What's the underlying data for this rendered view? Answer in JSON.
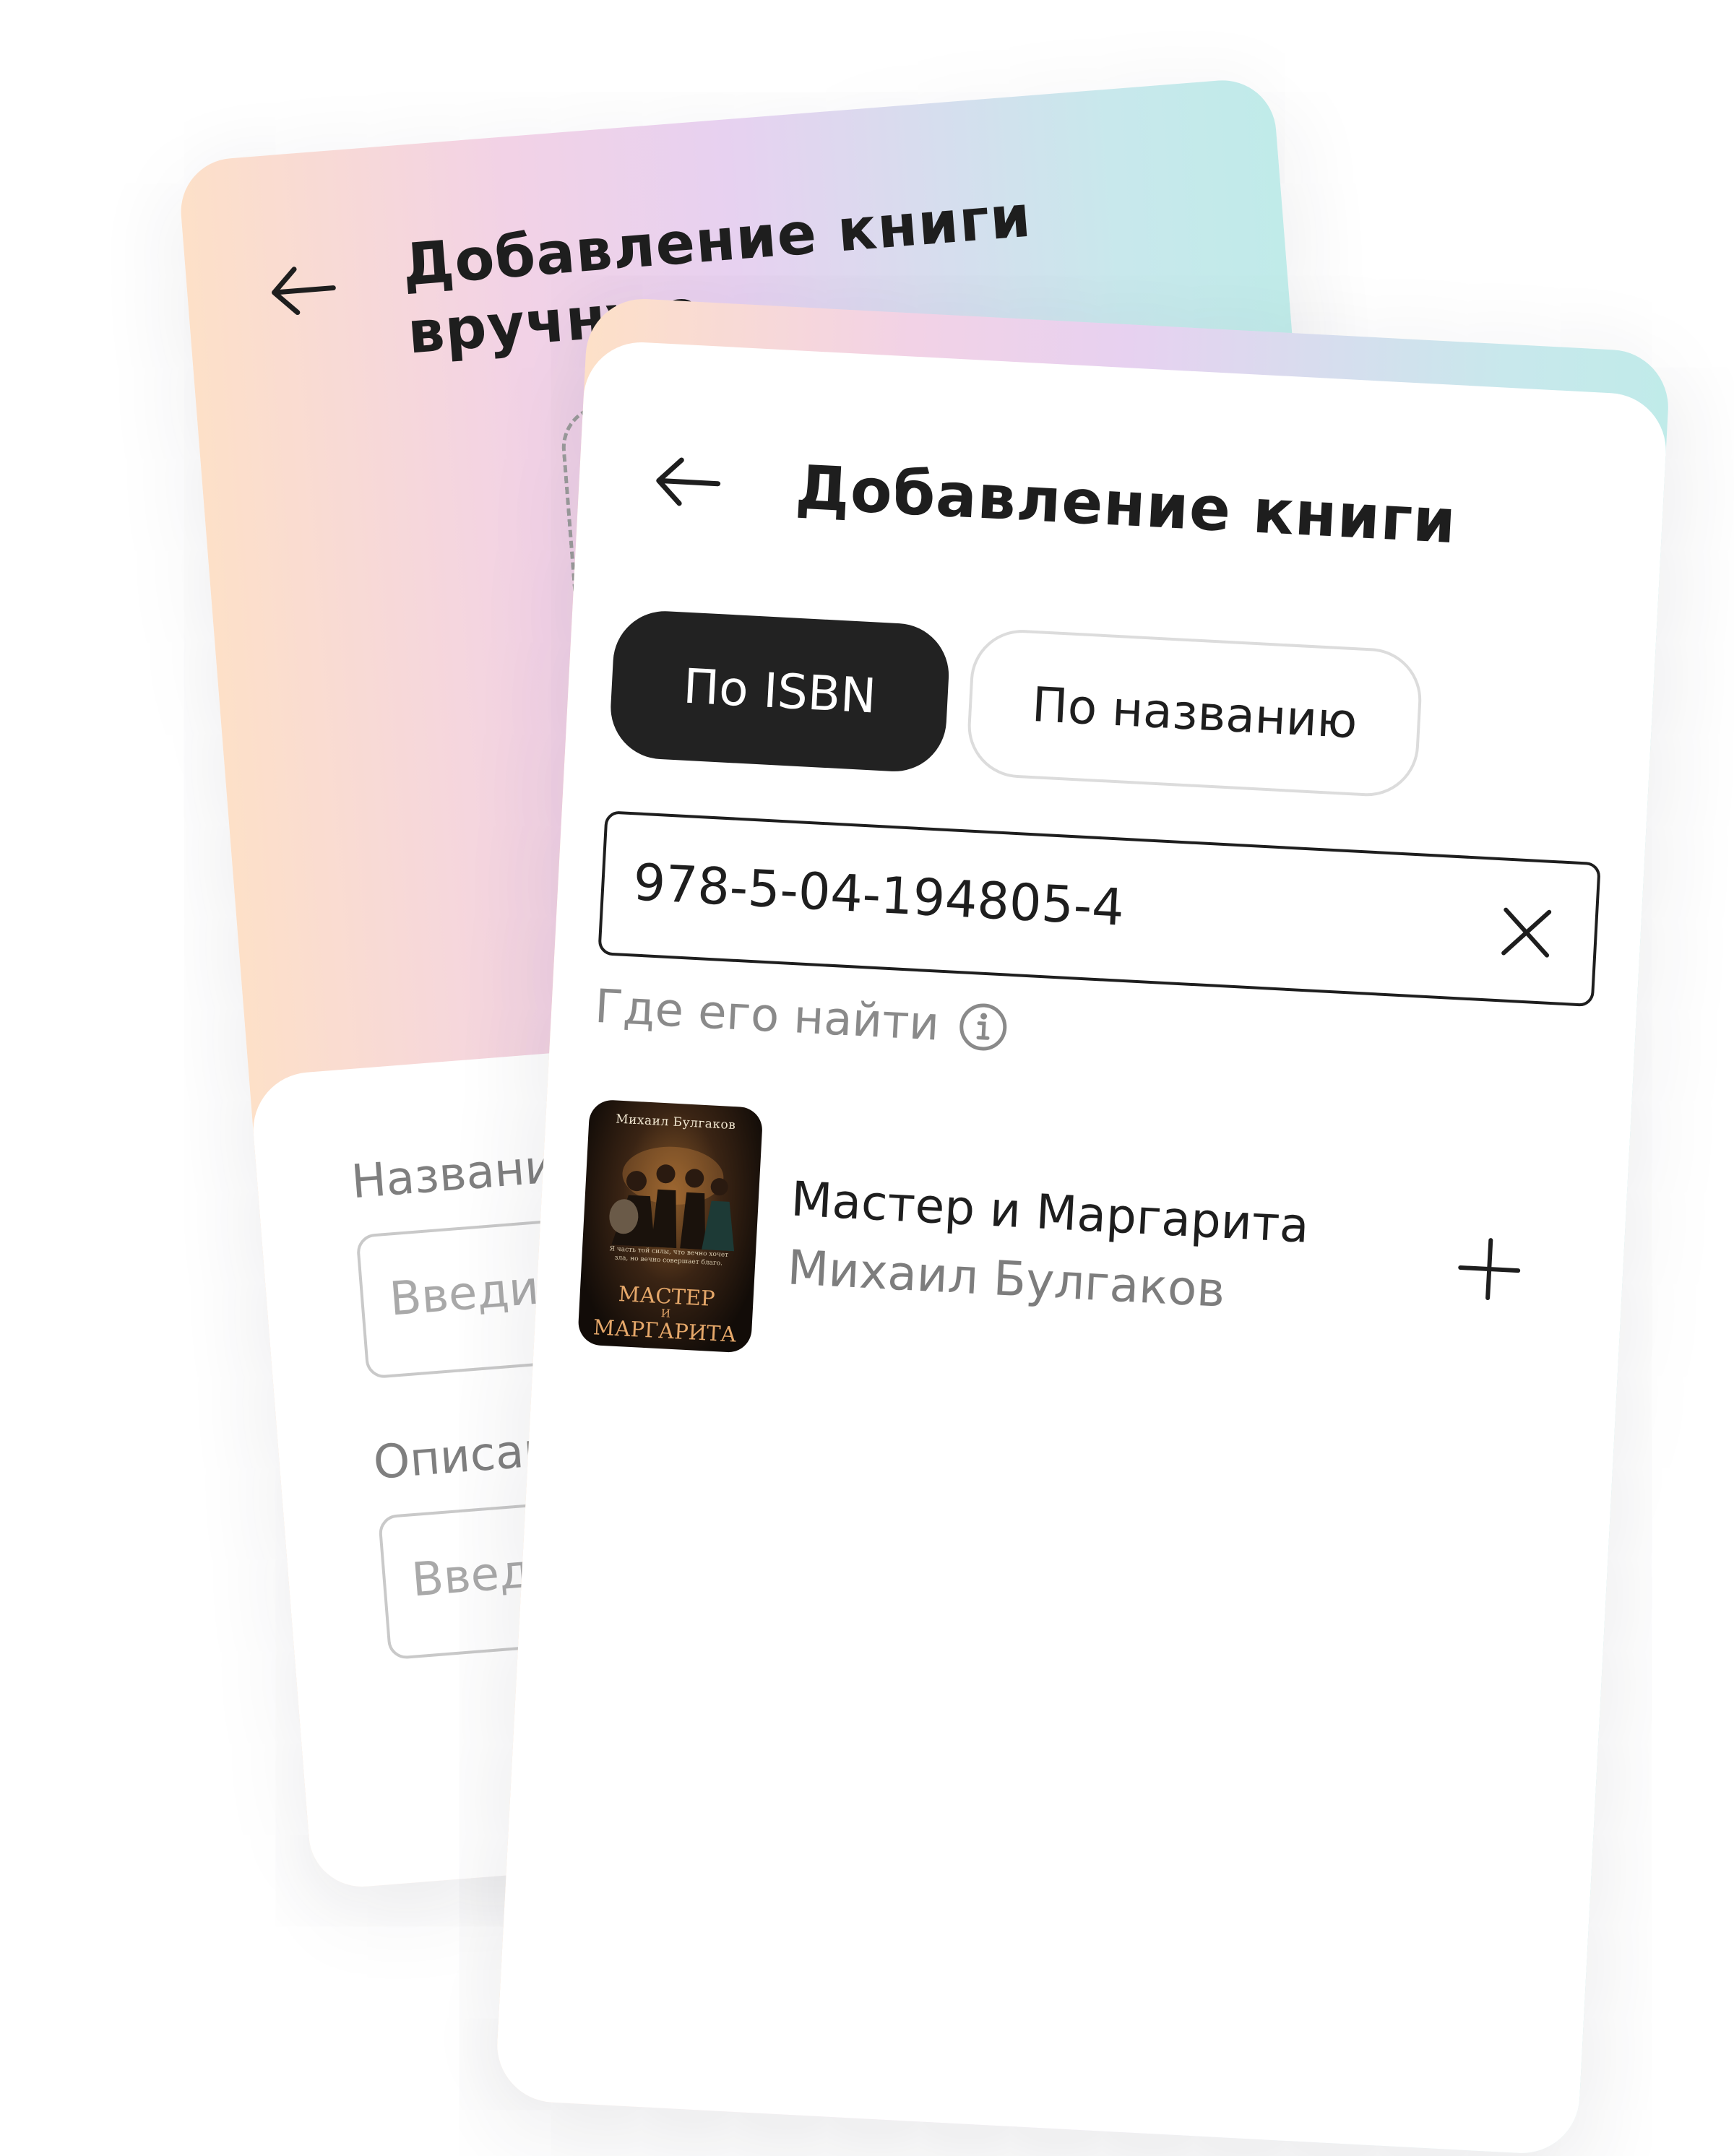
{
  "manual_screen": {
    "title": "Добавление книги вручную",
    "back_icon": "arrow-left-icon",
    "fields": [
      {
        "label": "Название",
        "placeholder": "Введите название"
      },
      {
        "label": "Описание",
        "placeholder": "Введите описание"
      }
    ]
  },
  "search_screen": {
    "title": "Добавление книги",
    "back_icon": "arrow-left-icon",
    "tabs": [
      {
        "label": "По ISBN",
        "active": true
      },
      {
        "label": "По названию",
        "active": false
      }
    ],
    "isbn_input": {
      "value": "978-5-04-194805-4",
      "clear_icon": "close-icon"
    },
    "hint": {
      "text": "Где его найти",
      "icon": "info-icon"
    },
    "result": {
      "title": "Мастер и Маргарита",
      "author": "Михаил Булгаков",
      "add_icon": "plus-icon",
      "cover": {
        "author": "Михаил Булгаков",
        "tagline": "Я часть той силы, что вечно хочет зла, но вечно совершает благо.",
        "title_line1": "МАСТЕР",
        "title_line2": "И",
        "title_line3": "МАРГАРИТА"
      }
    }
  },
  "colors": {
    "gradient": [
      "#fde0c8",
      "#f2d2e6",
      "#e7d1f0",
      "#c0ebe9"
    ],
    "active_tab": "#222222",
    "text": "#1e1e1e",
    "muted": "#7d7d7d"
  }
}
